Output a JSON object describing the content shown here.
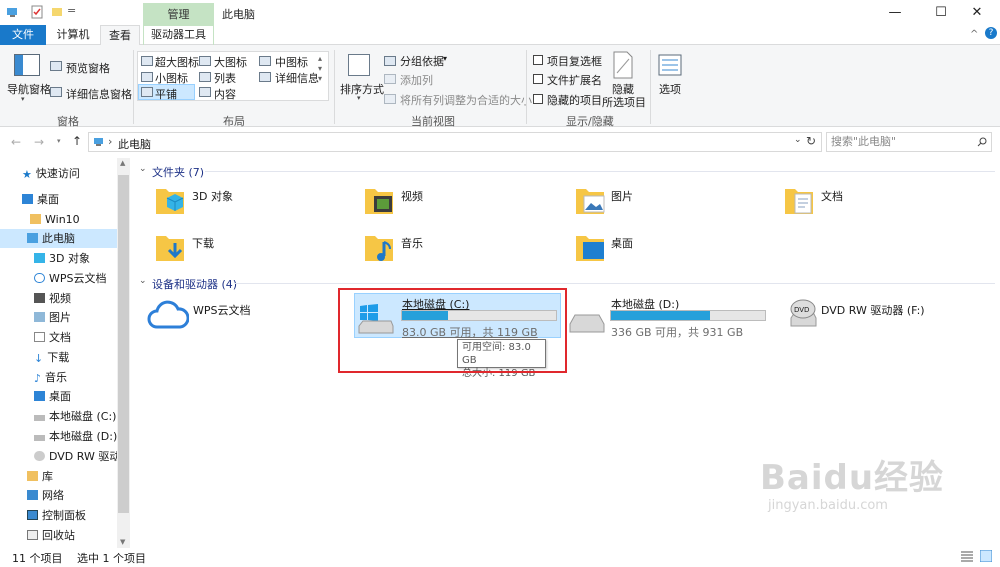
{
  "titlebar": {
    "manage_label": "管理",
    "title": "此电脑",
    "quick_access_more": "=",
    "minimize": "—",
    "maximize": "☐",
    "close": "✕"
  },
  "tabs": {
    "file": "文件",
    "computer": "计算机",
    "view": "查看",
    "drive_tools": "驱动器工具",
    "expand": "^"
  },
  "ribbon": {
    "pane_group": {
      "nav_pane": "导航窗格",
      "preview_pane": "预览窗格",
      "details_pane": "详细信息窗格",
      "label": "窗格"
    },
    "layout_group": {
      "items": [
        "超大图标",
        "大图标",
        "中图标",
        "小图标",
        "列表",
        "详细信息",
        "平铺",
        "内容"
      ],
      "label": "布局"
    },
    "view_group": {
      "sort_by": "排序方式",
      "group_by": "分组依据",
      "add_column": "添加列",
      "fit_columns": "将所有列调整为合适的大小",
      "label": "当前视图"
    },
    "show_hide_group": {
      "item_checkbox": "项目复选框",
      "file_ext": "文件扩展名",
      "hidden_items": "隐藏的项目",
      "hide_selected_line1": "隐藏",
      "hide_selected_line2": "所选项目",
      "label": "显示/隐藏"
    },
    "options": "选项"
  },
  "address": {
    "path": "此电脑",
    "search_placeholder": "搜索\"此电脑\""
  },
  "nav": {
    "items": [
      "快速访问",
      "桌面",
      "Win10",
      "此电脑",
      "3D 对象",
      "WPS云文档",
      "视频",
      "图片",
      "文档",
      "下载",
      "音乐",
      "桌面",
      "本地磁盘 (C:)",
      "本地磁盘 (D:)",
      "DVD RW 驱动器",
      "库",
      "网络",
      "控制面板",
      "回收站"
    ]
  },
  "content": {
    "folders_header": "文件夹 (7)",
    "folders": [
      "3D 对象",
      "视频",
      "图片",
      "文档",
      "下载",
      "音乐",
      "桌面"
    ],
    "devices_header": "设备和驱动器 (4)",
    "wps": "WPS云文档",
    "drive_c": {
      "name": "本地磁盘 (C:)",
      "info": "83.0 GB 可用，共 119 GB",
      "used_fraction": 0.3
    },
    "drive_d": {
      "name": "本地磁盘 (D:)",
      "info": "336 GB 可用，共 931 GB",
      "used_fraction": 0.64
    },
    "dvd": "DVD RW 驱动器 (F:)",
    "tooltip_line1": "可用空间: 83.0 GB",
    "tooltip_line2": "总大小: 119 GB"
  },
  "status": {
    "count": "11 个项目",
    "selected": "选中 1 个项目"
  },
  "watermark": {
    "line1": "Baidu经验",
    "line2": "jingyan.baidu.com"
  },
  "colors": {
    "accent": "#1979ca",
    "drive_bar": "#26a0da",
    "selection": "#cce8ff",
    "highlight": "#e0282d"
  }
}
